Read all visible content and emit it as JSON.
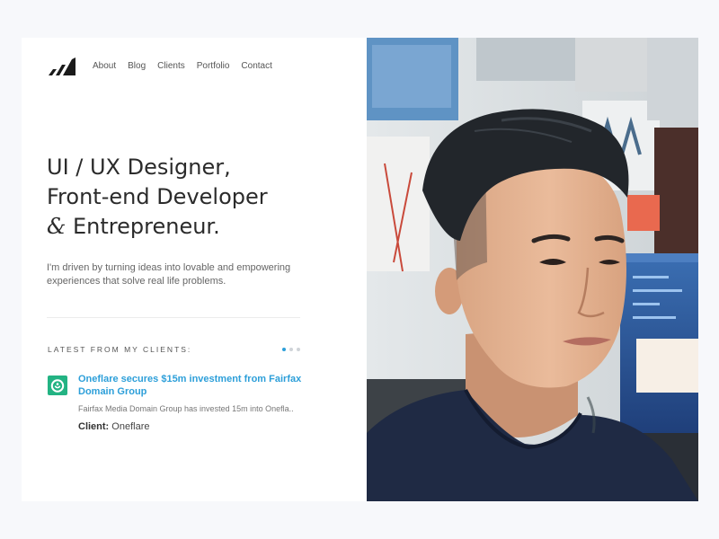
{
  "nav": {
    "items": [
      "About",
      "Blog",
      "Clients",
      "Portfolio",
      "Contact"
    ]
  },
  "hero": {
    "line1": "UI / UX Designer,",
    "line2": "Front-end Developer",
    "line3_amp": "&",
    "line3_rest": " Entrepreneur.",
    "tagline": "I'm driven by turning ideas into lovable and empowering experiences that solve real life problems."
  },
  "latest": {
    "label": "LATEST FROM MY CLIENTS:",
    "pager_count": 3,
    "pager_active_index": 0,
    "news_title": "Oneflare secures $15m investment from Fairfax Domain Group",
    "news_desc": "Fairfax Media Domain Group has invested 15m into Onefla..",
    "client_label": "Client:",
    "client_name": "Oneflare"
  },
  "colors": {
    "accent": "#2d9fd9",
    "client_logo": "#23b383"
  },
  "icons": {
    "logo": "bar-chart-logo-icon",
    "client": "oneflare-logo-icon"
  }
}
